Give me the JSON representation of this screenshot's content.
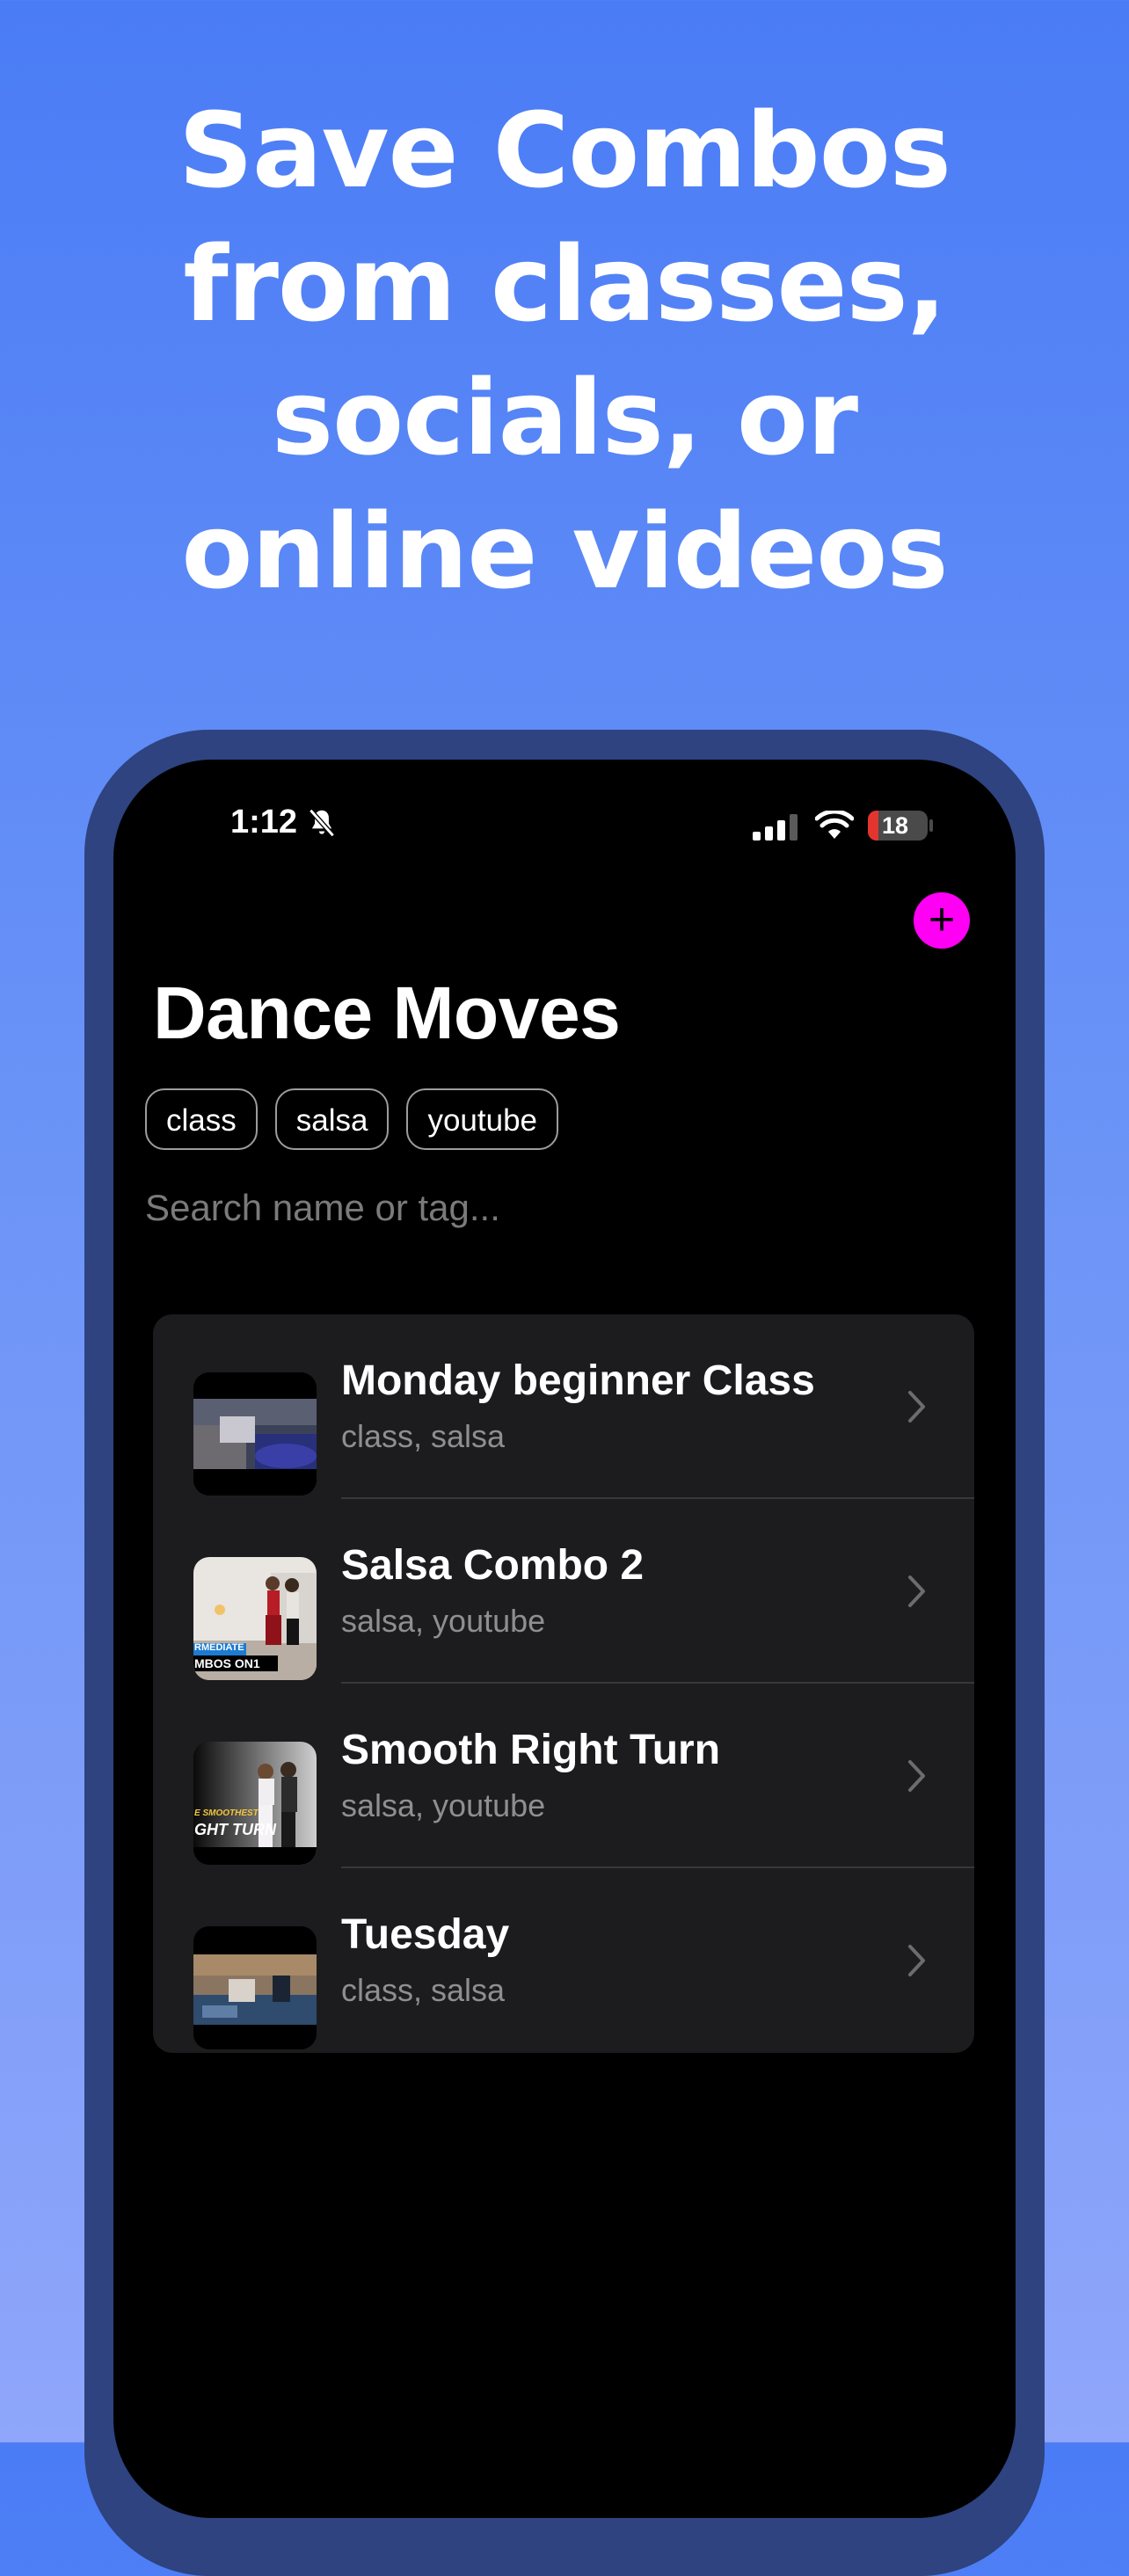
{
  "headline": {
    "line1": "Save Combos",
    "line2": "from classes,",
    "line3": "socials, or",
    "line4": "online videos"
  },
  "status_bar": {
    "time": "1:12",
    "battery": "18",
    "battery_percent": 18
  },
  "screen": {
    "title": "Dance Moves",
    "tags": [
      "class",
      "salsa",
      "youtube"
    ],
    "search_placeholder": "Search name or tag..."
  },
  "moves": [
    {
      "name": "Monday beginner Class",
      "tags": "class, salsa"
    },
    {
      "name": "Salsa Combo 2",
      "tags": "salsa, youtube"
    },
    {
      "name": "Smooth Right Turn",
      "tags": "salsa, youtube"
    },
    {
      "name": "Tuesday",
      "tags": "class, salsa"
    }
  ],
  "thumbnail_text": {
    "combo2_line1": "RMEDIATE",
    "combo2_line2": "MBOS ON1",
    "turn_line1": "E SMOOTHEST",
    "turn_line2": "GHT TURN"
  },
  "colors": {
    "accent": "#ff00f5",
    "background_top": "#4a7cf6",
    "background_bottom": "#8fa6fa",
    "card": "#1c1c1e"
  }
}
